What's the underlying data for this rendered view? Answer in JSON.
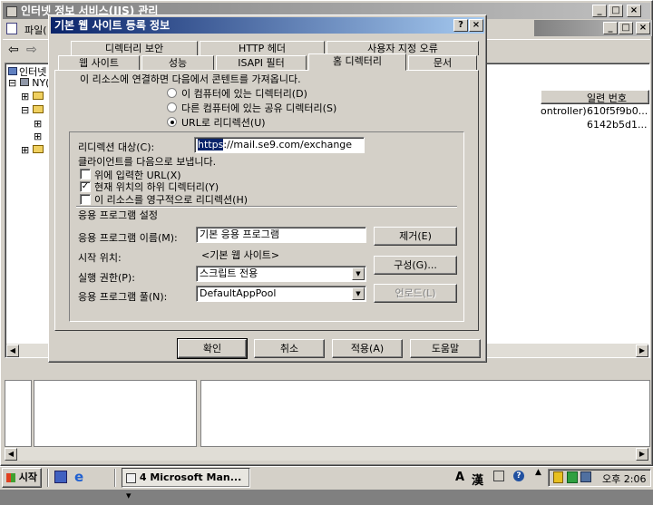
{
  "main_window": {
    "title": "인터넷 정보 서비스(IIS) 관리",
    "menu_file": "파일(",
    "tree": {
      "root": "인터넷",
      "server": "NY("
    },
    "right_panel": {
      "column_serial": "일련 번호",
      "row1_col1": "ontroller)",
      "row1_col2": "610f5f9b0...",
      "row2_col2": "6142b5d1..."
    }
  },
  "dialog": {
    "title": "기본 웹 사이트 등록 정보",
    "help_button": "?",
    "close_button": "×",
    "tabs_row1": [
      "디렉터리 보안",
      "HTTP 헤더",
      "사용자 지정 오류"
    ],
    "tabs_row2": [
      "웹 사이트",
      "성능",
      "ISAPI 필터",
      "홈 디렉터리",
      "문서"
    ],
    "content_intro": "이 리소스에 연결하면 다음에서 콘텐트를 가져옵니다.",
    "source_options": [
      "이 컴퓨터에 있는 디렉터리(D)",
      "다른 컴퓨터에 있는 공유 디렉터리(S)",
      "URL로 리디렉션(U)"
    ],
    "redirect_label": "리디렉션 대상(C):",
    "redirect_value_sel": "https",
    "redirect_value_rest": "://mail.se9.com/exchange",
    "client_sent_label": "클라이언트를 다음으로 보냅니다.",
    "check_options": [
      {
        "label": "위에 입력한 URL(X)",
        "checked": false
      },
      {
        "label": "현재 위치의 하위 디렉터리(Y)",
        "checked": true
      },
      {
        "label": "이 리소스를 영구적으로 리디렉션(H)",
        "checked": false
      }
    ],
    "app_settings_label": "응용 프로그램 설정",
    "app_name_label": "응용 프로그램 이름(M):",
    "app_name_value": "기본 응용 프로그램",
    "start_point_label": "시작 위치:",
    "start_point_value": "<기본 웹 사이트>",
    "exec_perm_label": "실행 권한(P):",
    "exec_perm_value": "스크립트 전용",
    "app_pool_label": "응용 프로그램 풀(N):",
    "app_pool_value": "DefaultAppPool",
    "remove_button": "제거(E)",
    "config_button": "구성(G)...",
    "unload_button": "언로드(L)",
    "ok_button": "확인",
    "cancel_button": "취소",
    "apply_button": "적용(A)",
    "help_text_button": "도움말"
  },
  "taskbar": {
    "start_label": "시작",
    "task_label": "4 Microsoft Man...",
    "ime_a": "A",
    "ime_han": "漢",
    "time": "오후 2:06"
  }
}
